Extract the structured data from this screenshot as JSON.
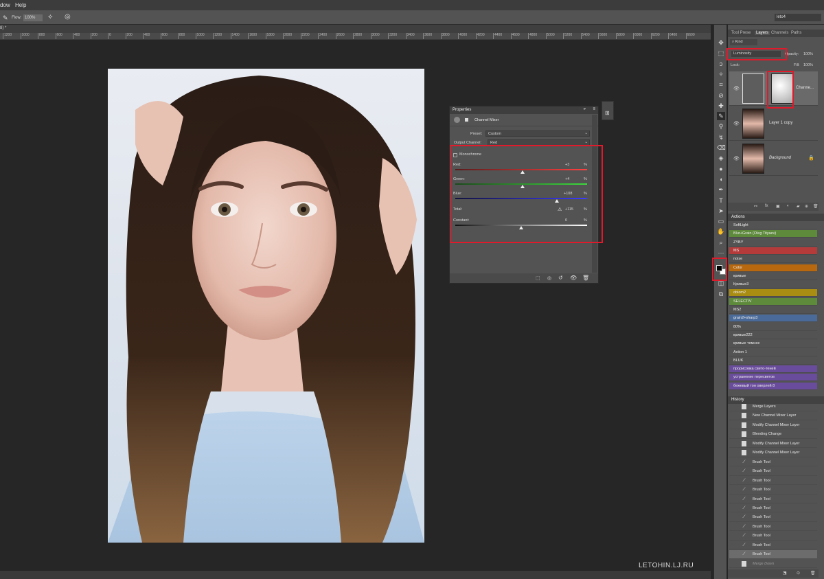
{
  "menu": {
    "window_label": "dow",
    "help_label": "Help"
  },
  "options_bar": {
    "flow_label": "Flow:",
    "flow_value": "100%",
    "workspace": "leto4"
  },
  "doc_tab": {
    "label": "8) *"
  },
  "ruler_ticks": [
    "1200",
    "1000",
    "800",
    "600",
    "400",
    "200",
    "0",
    "200",
    "400",
    "600",
    "800",
    "1000",
    "1200",
    "1400",
    "1600",
    "1800",
    "2000",
    "2200",
    "2400",
    "2600",
    "2800",
    "3000",
    "3200",
    "3400",
    "3600",
    "3800",
    "4000",
    "4200",
    "4400",
    "4600",
    "4800",
    "5000",
    "5200",
    "5400",
    "5600",
    "5800",
    "6000",
    "6200",
    "6400",
    "6600"
  ],
  "properties": {
    "tab": "Properties",
    "title": "Channel Mixer",
    "preset_label": "Preset:",
    "preset_value": "Custom",
    "output_label": "Output Channel:",
    "output_value": "Red",
    "monochrome": "Monochrome",
    "red_label": "Red:",
    "red_value": "+3",
    "green_label": "Green:",
    "green_value": "+4",
    "blue_label": "Blue:",
    "blue_value": "+108",
    "total_label": "Total:",
    "total_value": "+115",
    "constant_label": "Constant:",
    "constant_value": "0",
    "pct": "%",
    "warning_icon": "warning-icon"
  },
  "right_tabs": {
    "tool_preset": "Tool Prese",
    "layers": "Layers",
    "channels": "Channels",
    "paths": "Paths"
  },
  "layers_panel": {
    "kind_label": "Kind",
    "blend_mode": "Luminosity",
    "opacity_label": "Opacity:",
    "opacity_value": "100%",
    "lock_label": "Lock:",
    "fill_label": "Fill:",
    "fill_value": "100%",
    "layers": [
      {
        "name": "Channe..."
      },
      {
        "name": "Layer 1 copy"
      },
      {
        "name": "Background"
      }
    ]
  },
  "actions": {
    "title": "Actions",
    "items": [
      {
        "label": "SoftLight",
        "color": "#535353"
      },
      {
        "label": "Blur+Grain (Oleg Tityaev)",
        "color": "#5e8a3c"
      },
      {
        "label": "ZYBY",
        "color": "#535353"
      },
      {
        "label": "MS",
        "color": "#b53b3b"
      },
      {
        "label": "noise",
        "color": "#535353"
      },
      {
        "label": "Color",
        "color": "#b8690f"
      },
      {
        "label": "кривые",
        "color": "#535353"
      },
      {
        "label": "Кривые3",
        "color": "#535353"
      },
      {
        "label": "obiom2",
        "color": "#a98c12"
      },
      {
        "label": "SELECTIV",
        "color": "#5e8a3c"
      },
      {
        "label": "MS2",
        "color": "#535353"
      },
      {
        "label": "grain2+sharp3",
        "color": "#4a6b9a"
      },
      {
        "label": "80%",
        "color": "#535353"
      },
      {
        "label": "кривые222",
        "color": "#535353"
      },
      {
        "label": "кривые темнее",
        "color": "#535353"
      },
      {
        "label": "Action 1",
        "color": "#535353"
      },
      {
        "label": "BLUK",
        "color": "#535353"
      },
      {
        "label": "прорисовка свето-теней",
        "color": "#6a4c9c"
      },
      {
        "label": "устранение пересветов",
        "color": "#6a4c9c"
      },
      {
        "label": "бежевый тон оверлей 8",
        "color": "#6a4c9c"
      }
    ]
  },
  "history": {
    "title": "History",
    "items": [
      {
        "label": "Merge Layers",
        "icon": "doc"
      },
      {
        "label": "New Channel Mixer Layer",
        "icon": "doc"
      },
      {
        "label": "Modify Channel Mixer Layer",
        "icon": "doc"
      },
      {
        "label": "Blending Change",
        "icon": "doc"
      },
      {
        "label": "Modify Channel Mixer Layer",
        "icon": "doc"
      },
      {
        "label": "Modify Channel Mixer Layer",
        "icon": "doc"
      },
      {
        "label": "Brush Tool",
        "icon": "brush"
      },
      {
        "label": "Brush Tool",
        "icon": "brush"
      },
      {
        "label": "Brush Tool",
        "icon": "brush"
      },
      {
        "label": "Brush Tool",
        "icon": "brush"
      },
      {
        "label": "Brush Tool",
        "icon": "brush"
      },
      {
        "label": "Brush Tool",
        "icon": "brush"
      },
      {
        "label": "Brush Tool",
        "icon": "brush"
      },
      {
        "label": "Brush Tool",
        "icon": "brush"
      },
      {
        "label": "Brush Tool",
        "icon": "brush"
      },
      {
        "label": "Brush Tool",
        "icon": "brush"
      },
      {
        "label": "Brush Tool",
        "icon": "brush"
      },
      {
        "label": "Merge Down",
        "icon": "doc"
      }
    ]
  },
  "watermark": "LETOHIN.LJ.RU",
  "colors": {
    "highlight": "#e0192b",
    "panel": "#535353"
  }
}
